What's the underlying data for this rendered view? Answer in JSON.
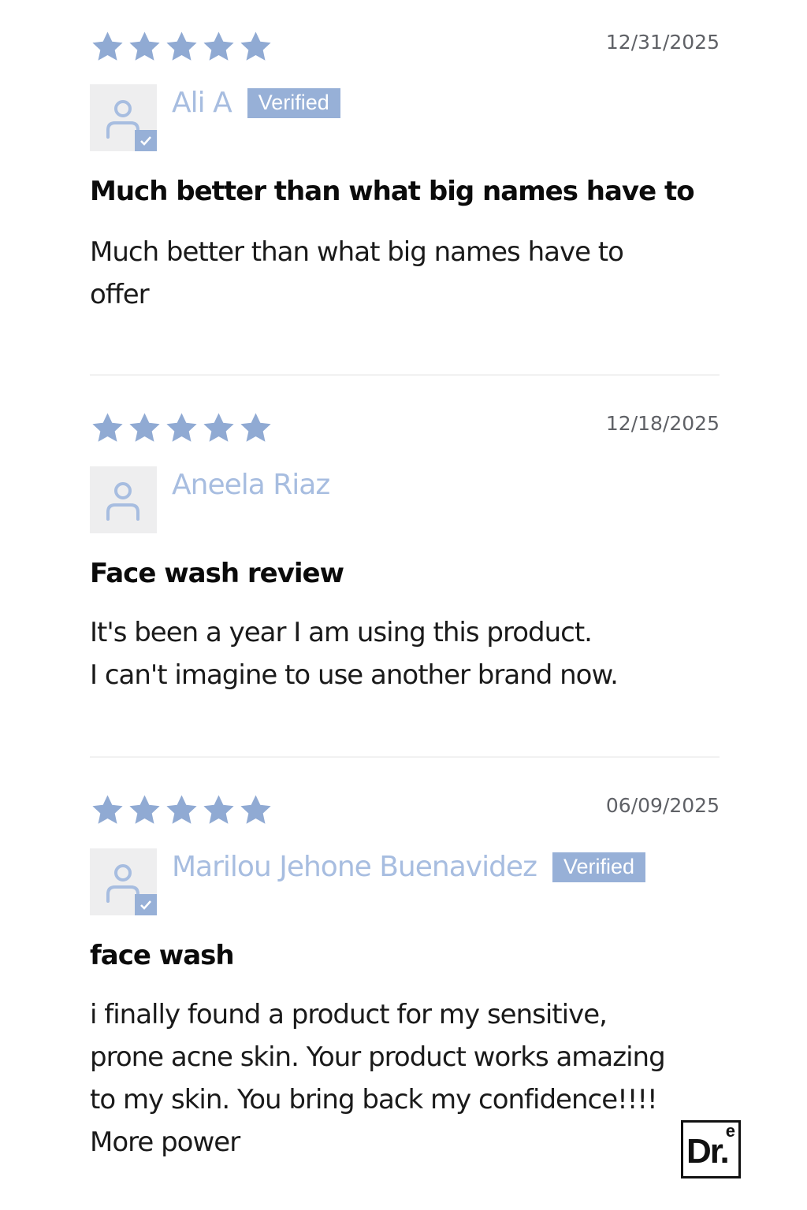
{
  "colors": {
    "star": "#90aad3",
    "author_name": "#a7bde0",
    "verified_badge_bg": "#97b0d7",
    "avatar_bg": "#eeeeef",
    "date_text": "#5f6166",
    "title_text": "#0b0b0b",
    "body_text": "#1a1a1a",
    "divider": "#f1f1f1"
  },
  "reviews": [
    {
      "rating": 5,
      "max_rating": 5,
      "date": "12/31/2025",
      "author": "Ali A",
      "verified": true,
      "verified_label": "Verified",
      "title": "Much better than what big names have to",
      "body_lines": [
        "Much better than what big names have to",
        "offer"
      ]
    },
    {
      "rating": 5,
      "max_rating": 5,
      "date": "12/18/2025",
      "author": "Aneela Riaz",
      "verified": false,
      "title": "Face wash review",
      "body_lines": [
        "It's been a year I am using this product.",
        "I can't imagine to use another brand now."
      ]
    },
    {
      "rating": 5,
      "max_rating": 5,
      "date": "06/09/2025",
      "author": "Marilou Jehone Buenavidez",
      "verified": true,
      "verified_label": "Verified",
      "title": "face wash",
      "body_lines": [
        "i finally found a product for my sensitive,",
        "prone acne skin. Your product works amazing",
        "to my skin. You bring back my confidence!!!!",
        "More power"
      ]
    }
  ],
  "logo": {
    "text": "Dr.",
    "superscript": "e"
  }
}
